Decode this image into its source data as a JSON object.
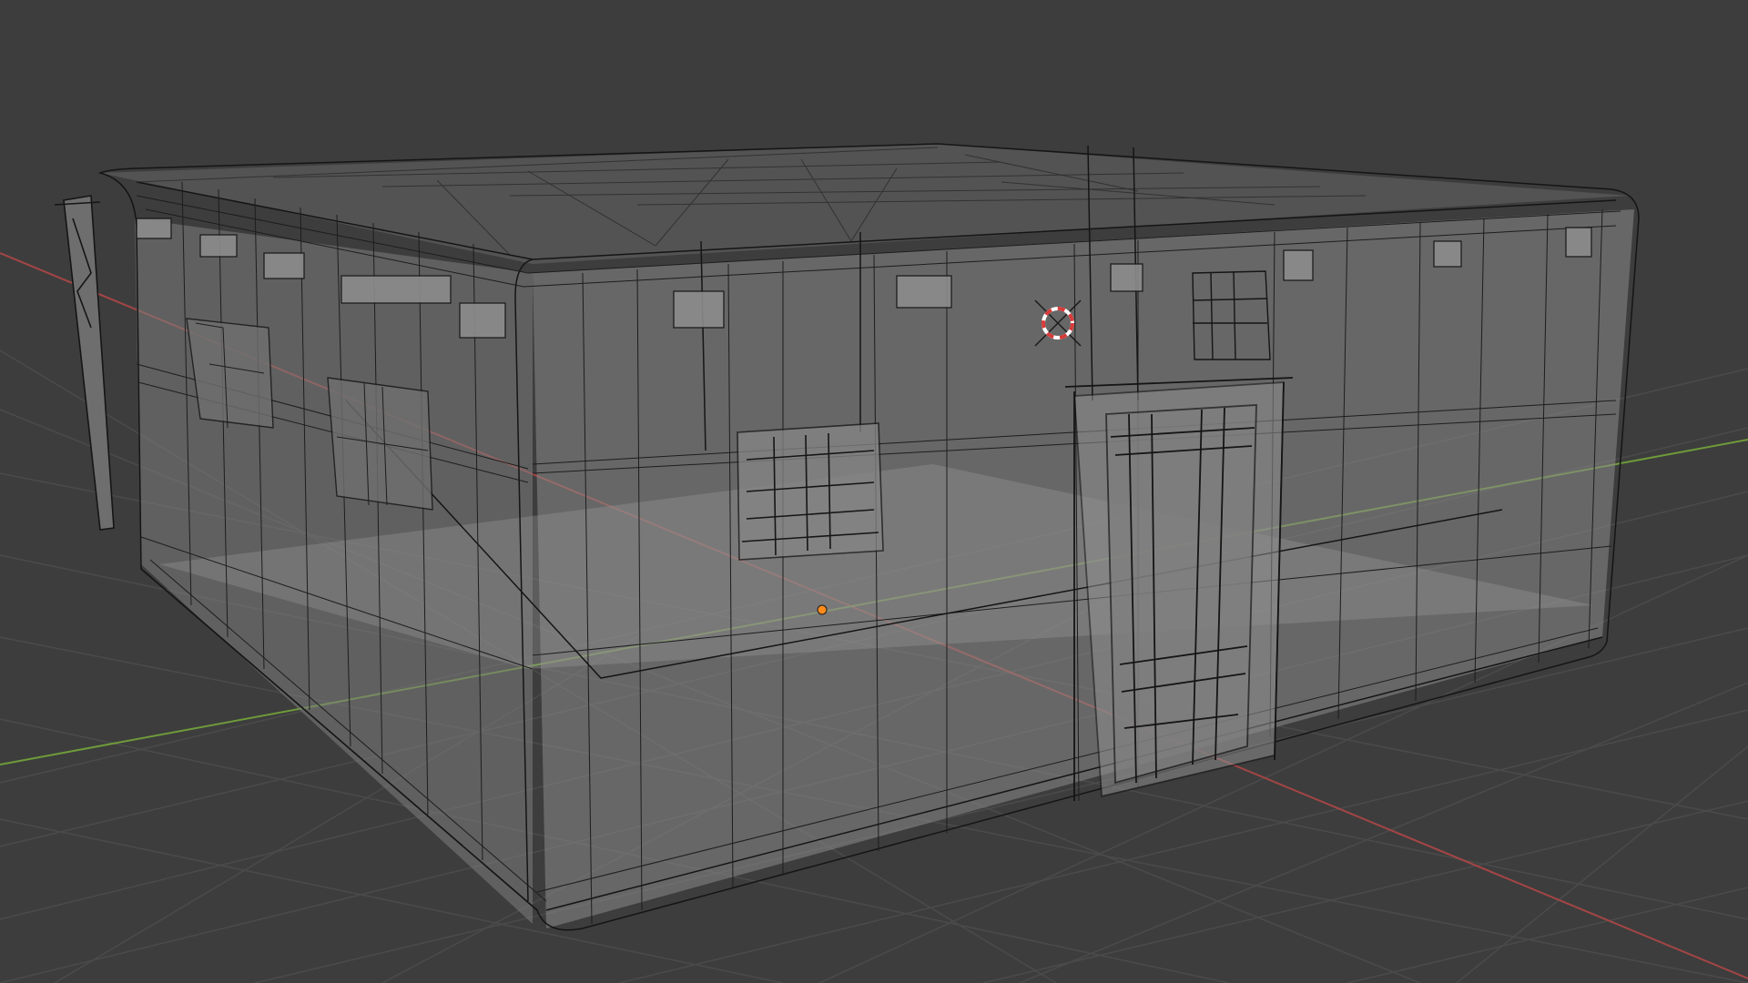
{
  "app": {
    "editor": "3D Viewport",
    "shading_mode": "wireframe-xray",
    "scene_object": "building"
  },
  "colors": {
    "background": "#3d3d3d",
    "grid": "#4a4a4a",
    "x_axis": "#a44545",
    "y_axis": "#6e9b3a",
    "wire": "#151515",
    "shell_fill": "#8a8a8a",
    "origin_dot": "#ff8c1a",
    "cursor_red": "#d83a3a",
    "cursor_white": "#ffffff"
  },
  "icons": {
    "cursor": "3d-cursor-icon",
    "origin": "object-origin-icon"
  }
}
